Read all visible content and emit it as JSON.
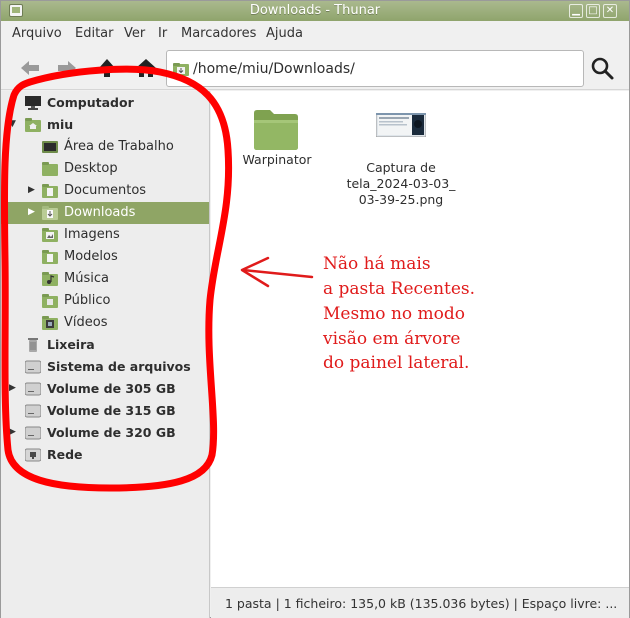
{
  "window": {
    "title": "Downloads - Thunar"
  },
  "menubar": {
    "items": [
      "Arquivo",
      "Editar",
      "Ver",
      "Ir",
      "Marcadores",
      "Ajuda"
    ]
  },
  "location": {
    "path": "/home/miu/Downloads/"
  },
  "sidebar": {
    "items": [
      {
        "label": "Computador"
      },
      {
        "label": "miu"
      },
      {
        "label": "Área de Trabalho"
      },
      {
        "label": "Desktop"
      },
      {
        "label": "Documentos"
      },
      {
        "label": "Downloads"
      },
      {
        "label": "Imagens"
      },
      {
        "label": "Modelos"
      },
      {
        "label": "Música"
      },
      {
        "label": "Público"
      },
      {
        "label": "Vídeos"
      },
      {
        "label": "Lixeira"
      },
      {
        "label": "Sistema de arquivos"
      },
      {
        "label": "Volume de 305 GB"
      },
      {
        "label": "Volume de 315 GB"
      },
      {
        "label": "Volume de 320 GB"
      },
      {
        "label": "Rede"
      }
    ]
  },
  "files": [
    {
      "name": "Warpinator"
    },
    {
      "name_lines": [
        "Captura de",
        "tela_2024-03-03_",
        "03-39-25.png"
      ]
    }
  ],
  "statusbar": {
    "text": "1 pasta  |  1 ficheiro: 135,0 kB (135.036 bytes)  |  Espaço livre: ..."
  },
  "annotation": {
    "lines": [
      "Não há mais",
      "a pasta Recentes.",
      "Mesmo no modo",
      "visão em árvore",
      "do painel lateral."
    ],
    "color": "#e01b1b"
  },
  "colors": {
    "accent": "#8fa565",
    "folder": "#8fb162"
  }
}
